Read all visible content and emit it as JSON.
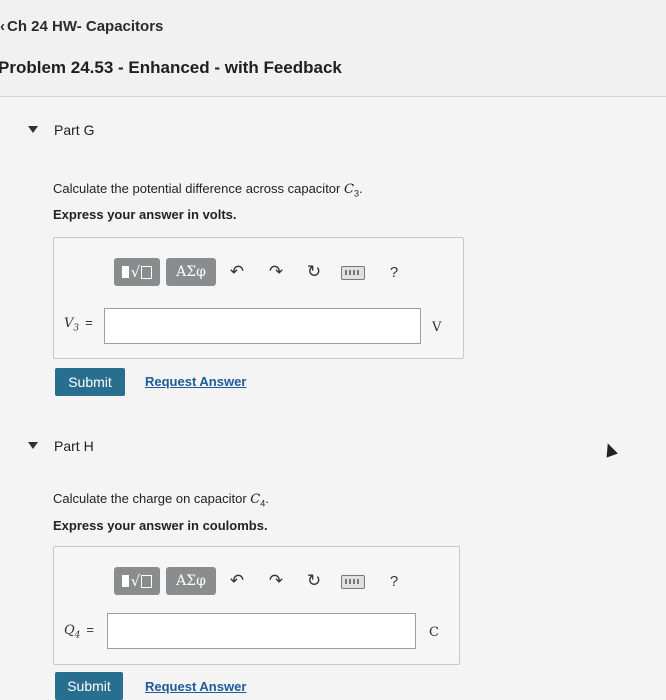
{
  "header": {
    "breadcrumb": "Ch 24 HW- Capacitors",
    "problem_title": "Problem 24.53 - Enhanced - with Feedback"
  },
  "toolbar": {
    "greek_label": "ΑΣφ",
    "undo_icon": "undo-icon",
    "redo_icon": "redo-icon",
    "reset_icon": "reset-icon",
    "keyboard_icon": "keyboard-icon",
    "help_label": "?"
  },
  "parts": [
    {
      "label": "Part G",
      "question_prefix": "Calculate the potential difference across capacitor ",
      "question_var": "C",
      "question_sub": "3",
      "question_suffix": ".",
      "instruction": "Express your answer in volts.",
      "var_label": "V",
      "var_sub": "3",
      "eq": "=",
      "input_value": "",
      "unit": "V",
      "submit_label": "Submit",
      "request_label": "Request Answer"
    },
    {
      "label": "Part H",
      "question_prefix": "Calculate the charge on capacitor ",
      "question_var": "C",
      "question_sub": "4",
      "question_suffix": ".",
      "instruction": "Express your answer in coulombs.",
      "var_label": "Q",
      "var_sub": "4",
      "eq": "=",
      "input_value": "",
      "unit": "C",
      "submit_label": "Submit",
      "request_label": "Request Answer"
    }
  ]
}
